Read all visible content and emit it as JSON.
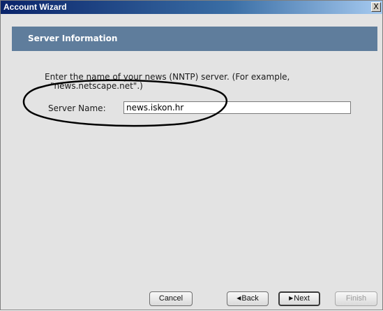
{
  "window": {
    "title": "Account Wizard",
    "close_label": "X"
  },
  "header": {
    "title": "Server Information"
  },
  "content": {
    "instruction_line1": "Enter the name of your news (NNTP) server. (For example,",
    "instruction_line2": "\"news.netscape.net\".)",
    "server_name_label": "Server Name:",
    "server_name_value": "news.iskon.hr"
  },
  "buttons": {
    "cancel": "Cancel",
    "back": "Back",
    "next": "Next",
    "finish": "Finish"
  },
  "colors": {
    "title_bar": "#0a246a",
    "header_band": "#5f7d9c",
    "background": "#e3e3e3",
    "annotation": "#000000"
  }
}
